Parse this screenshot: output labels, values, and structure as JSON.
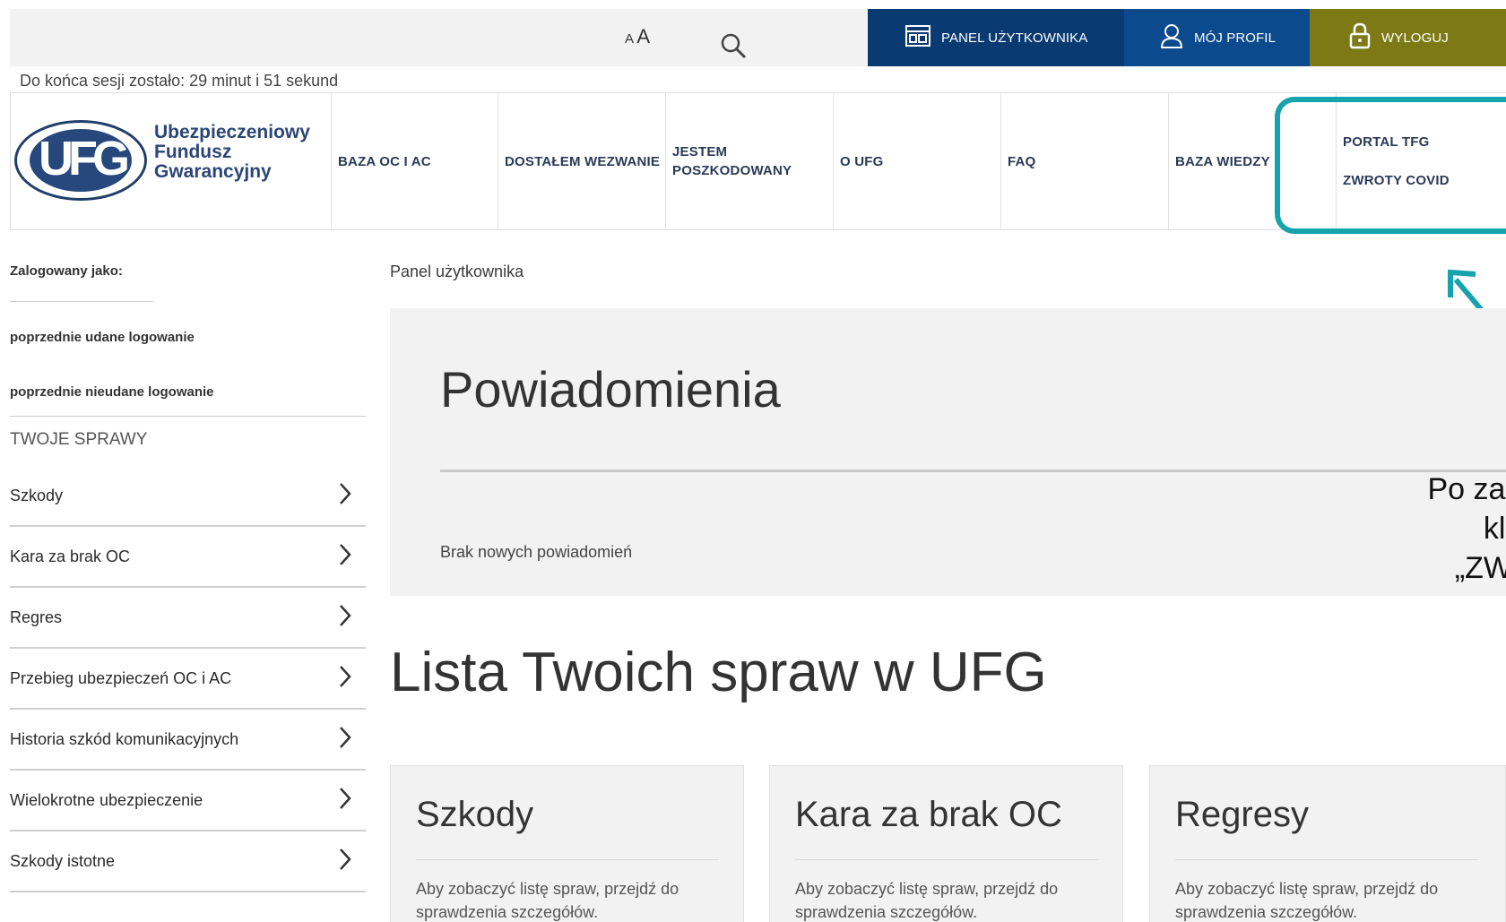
{
  "topbar": {
    "font_small": "A",
    "font_big": "A",
    "panel_label": "PANEL UŻYTKOWNIKA",
    "profil_label": "MÓJ PROFIL",
    "wyloguj_label": "WYLOGUJ"
  },
  "session": "Do końca sesji zostało: 29 minut i 51 sekund",
  "logo": {
    "mark": "UFG",
    "line1": "Ubezpieczeniowy",
    "line2": "Fundusz",
    "line3": "Gwarancyjny"
  },
  "nav": {
    "baza_oc": "BAZA OC I AC",
    "wezwanie": "DOSTAŁEM WEZWANIE",
    "jestem_1": "JESTEM",
    "jestem_2": "POSZKODOWANY",
    "oufg": "O UFG",
    "faq": "FAQ",
    "baza_wiedzy": "BAZA WIEDZY",
    "portal": "PORTAL TFG",
    "zwroty": "ZWROTY COVID"
  },
  "sidebar": {
    "logged_as": "Zalogowany jako:",
    "prev_ok": "poprzednie udane logowanie",
    "prev_fail": "poprzednie nieudane logowanie",
    "heading": "TWOJE SPRAWY",
    "items": [
      {
        "label": "Szkody"
      },
      {
        "label": "Kara za brak OC"
      },
      {
        "label": "Regres"
      },
      {
        "label": "Przebieg ubezpieczeń OC i AC"
      },
      {
        "label": "Historia szkód komunikacyjnych"
      },
      {
        "label": "Wielokrotne ubezpieczenie"
      },
      {
        "label": "Szkody istotne"
      }
    ]
  },
  "main": {
    "breadcrumb": "Panel użytkownika",
    "notif_title": "Powiadomienia",
    "notif_empty": "Brak nowych powiadomień",
    "note_line1": "Po zal",
    "note_line2": "kli",
    "note_line3": "„ZW",
    "lista_title": "Lista Twoich spraw w UFG",
    "cards": [
      {
        "title": "Szkody",
        "text": "Aby zobaczyć listę spraw, przejdź do sprawdzenia szczegółów."
      },
      {
        "title": "Kara za brak OC",
        "text": "Aby zobaczyć listę spraw, przejdź do sprawdzenia szczegółów."
      },
      {
        "title": "Regresy",
        "text": "Aby zobaczyć listę spraw, przejdź do sprawdzenia szczegółów."
      }
    ]
  },
  "colors": {
    "panel": "#0a3a72",
    "profil": "#0c4a8e",
    "wyloguj": "#7d7a16",
    "highlight": "#17a3ad"
  }
}
